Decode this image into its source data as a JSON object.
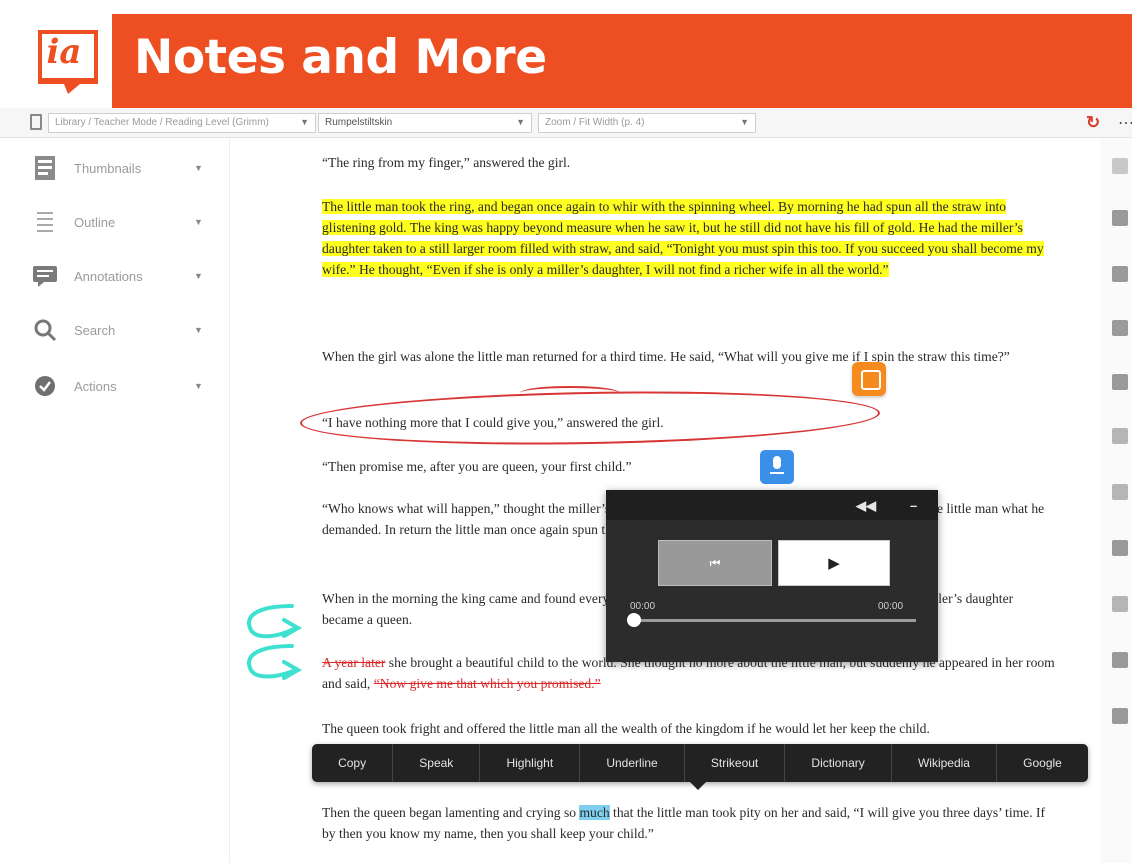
{
  "banner": {
    "title": "Notes and More",
    "logo_text": "ia",
    "bar_color": "#ee4f22"
  },
  "toolbar": {
    "select_1": "Library / Teacher Mode / Reading Level (Grimm)",
    "select_2": "Rumpelstiltskin",
    "select_3": "Zoom / Fit Width (p. 4)",
    "refresh_icon": "refresh-icon",
    "more_icon": "more-icon"
  },
  "sidebar": {
    "items": [
      {
        "label": "Thumbnails",
        "icon": "thumbnails-icon"
      },
      {
        "label": "Outline",
        "icon": "outline-icon"
      },
      {
        "label": "Annotations",
        "icon": "annotations-icon"
      },
      {
        "label": "Search",
        "icon": "search-icon"
      },
      {
        "label": "Actions",
        "icon": "actions-icon"
      }
    ]
  },
  "document": {
    "p1": "“The ring from my finger,” answered the girl.",
    "p2": "The little man took the ring, and began once again to whir with the spinning wheel. By morning he had spun all the straw into glistening gold. The king was happy beyond measure when he saw it, but he still did not have his fill of gold. He had the miller’s daughter taken to a still larger room filled with straw, and said, “Tonight you must spin this too. If you succeed you shall become my wife.” He thought, “Even if she is only a miller’s daughter, I will not find a richer wife in all the world.”",
    "p3": "When the girl was alone the little man returned for a third time. He said, “What will you give me if I spin the straw this time?”",
    "p4": "“I have nothing more that I could give you,” answered the girl.",
    "p5": "“Then promise me, after you are queen, your first child.”",
    "p6a": "“Who knows what will happen,” thought the miller’s daughter, and not knowing what else to do, she promised the little man what he demanded. In return the little man once again spun the straw into gold.",
    "p7a": "When in the morning the king came and found everything as he had wished, he married her, and the beautiful miller’s daughter became a queen.",
    "p8_struck": "A year later",
    "p8_body": " she brought a beautiful child to the world. She thought no more about the little man, but suddenly he appeared in her room and said, ",
    "p8_struck2": "“Now give me that which you promised.”",
    "p9": "The queen took fright and offered the little man all the wealth of the kingdom if he would let her keep the child.",
    "p10_pre": "Then the queen began lamenting and crying so ",
    "p10_hl": "much",
    "p10_post": " that the little man took pity on her and said, “I will give you three days’ time. If by then you know my name, then you shall keep your child.”"
  },
  "audio_player": {
    "prev_label": "⏮",
    "play_label": "▶",
    "time_start": "00:00",
    "time_end": "00:00",
    "progress": 0,
    "header_left": "◀◀",
    "header_right": "–"
  },
  "context_menu": {
    "items": [
      "Copy",
      "Speak",
      "Highlight",
      "Underline",
      "Strikeout",
      "Dictionary",
      "Wikipedia",
      "Google"
    ]
  },
  "colors": {
    "accent": "#ee4f22",
    "highlight_yellow": "#ffff20",
    "annotation_red": "#d83535",
    "annotation_teal": "#3fe0d0",
    "note_orange": "#f58a1e",
    "audio_blue": "#3a8fe8"
  }
}
